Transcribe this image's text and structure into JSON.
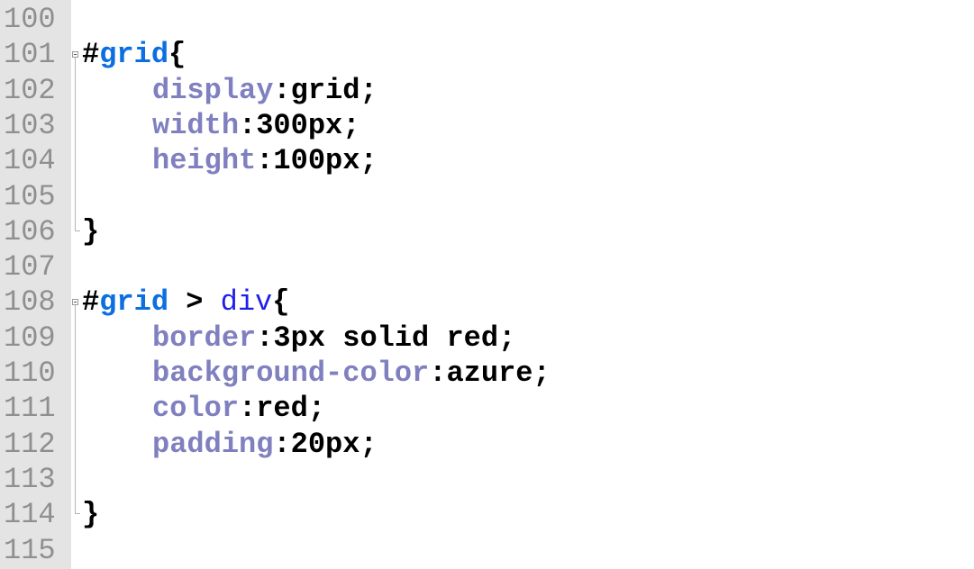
{
  "editor": {
    "lines": [
      {
        "no": "100",
        "tokens": []
      },
      {
        "no": "101",
        "tokens": [
          {
            "t": "#",
            "c": "sel"
          },
          {
            "t": "grid",
            "c": "id"
          },
          {
            "t": "{",
            "c": "punct"
          }
        ],
        "fold": "open"
      },
      {
        "no": "102",
        "indent": true,
        "tokens": [
          {
            "t": "display",
            "c": "prop"
          },
          {
            "t": ":",
            "c": "punct"
          },
          {
            "t": "grid",
            "c": "val"
          },
          {
            "t": ";",
            "c": "punct"
          }
        ]
      },
      {
        "no": "103",
        "indent": true,
        "tokens": [
          {
            "t": "width",
            "c": "prop"
          },
          {
            "t": ":",
            "c": "punct"
          },
          {
            "t": "300px",
            "c": "val"
          },
          {
            "t": ";",
            "c": "punct"
          }
        ]
      },
      {
        "no": "104",
        "indent": true,
        "tokens": [
          {
            "t": "height",
            "c": "prop"
          },
          {
            "t": ":",
            "c": "punct"
          },
          {
            "t": "100px",
            "c": "val"
          },
          {
            "t": ";",
            "c": "punct"
          }
        ]
      },
      {
        "no": "105",
        "tokens": []
      },
      {
        "no": "106",
        "tokens": [
          {
            "t": "}",
            "c": "punct"
          }
        ],
        "fold": "end"
      },
      {
        "no": "107",
        "tokens": []
      },
      {
        "no": "108",
        "tokens": [
          {
            "t": "#",
            "c": "sel"
          },
          {
            "t": "grid",
            "c": "id"
          },
          {
            "t": " > ",
            "c": "sel"
          },
          {
            "t": "div",
            "c": "tag"
          },
          {
            "t": "{",
            "c": "punct"
          }
        ],
        "fold": "open"
      },
      {
        "no": "109",
        "indent": true,
        "tokens": [
          {
            "t": "border",
            "c": "prop"
          },
          {
            "t": ":",
            "c": "punct"
          },
          {
            "t": "3px solid red",
            "c": "val"
          },
          {
            "t": ";",
            "c": "punct"
          }
        ]
      },
      {
        "no": "110",
        "indent": true,
        "tokens": [
          {
            "t": "background-color",
            "c": "prop"
          },
          {
            "t": ":",
            "c": "punct"
          },
          {
            "t": "azure",
            "c": "val"
          },
          {
            "t": ";",
            "c": "punct"
          }
        ]
      },
      {
        "no": "111",
        "indent": true,
        "tokens": [
          {
            "t": "color",
            "c": "prop"
          },
          {
            "t": ":",
            "c": "punct"
          },
          {
            "t": "red",
            "c": "val"
          },
          {
            "t": ";",
            "c": "punct"
          }
        ]
      },
      {
        "no": "112",
        "indent": true,
        "tokens": [
          {
            "t": "padding",
            "c": "prop"
          },
          {
            "t": ":",
            "c": "punct"
          },
          {
            "t": "20px",
            "c": "val"
          },
          {
            "t": ";",
            "c": "punct"
          }
        ]
      },
      {
        "no": "113",
        "tokens": []
      },
      {
        "no": "114",
        "tokens": [
          {
            "t": "}",
            "c": "punct"
          }
        ],
        "fold": "end"
      },
      {
        "no": "115",
        "tokens": []
      }
    ]
  },
  "colors": {
    "gutter_bg": "#e4e4e4",
    "line_number": "#8f8f8f",
    "id_selector": "#0b6fe0",
    "tag_selector": "#1f1fe8",
    "property": "#8080c0",
    "value": "#000000"
  },
  "icons": {
    "fold_open": "fold-minus-box-icon",
    "fold_end": "fold-end-marker-icon"
  }
}
